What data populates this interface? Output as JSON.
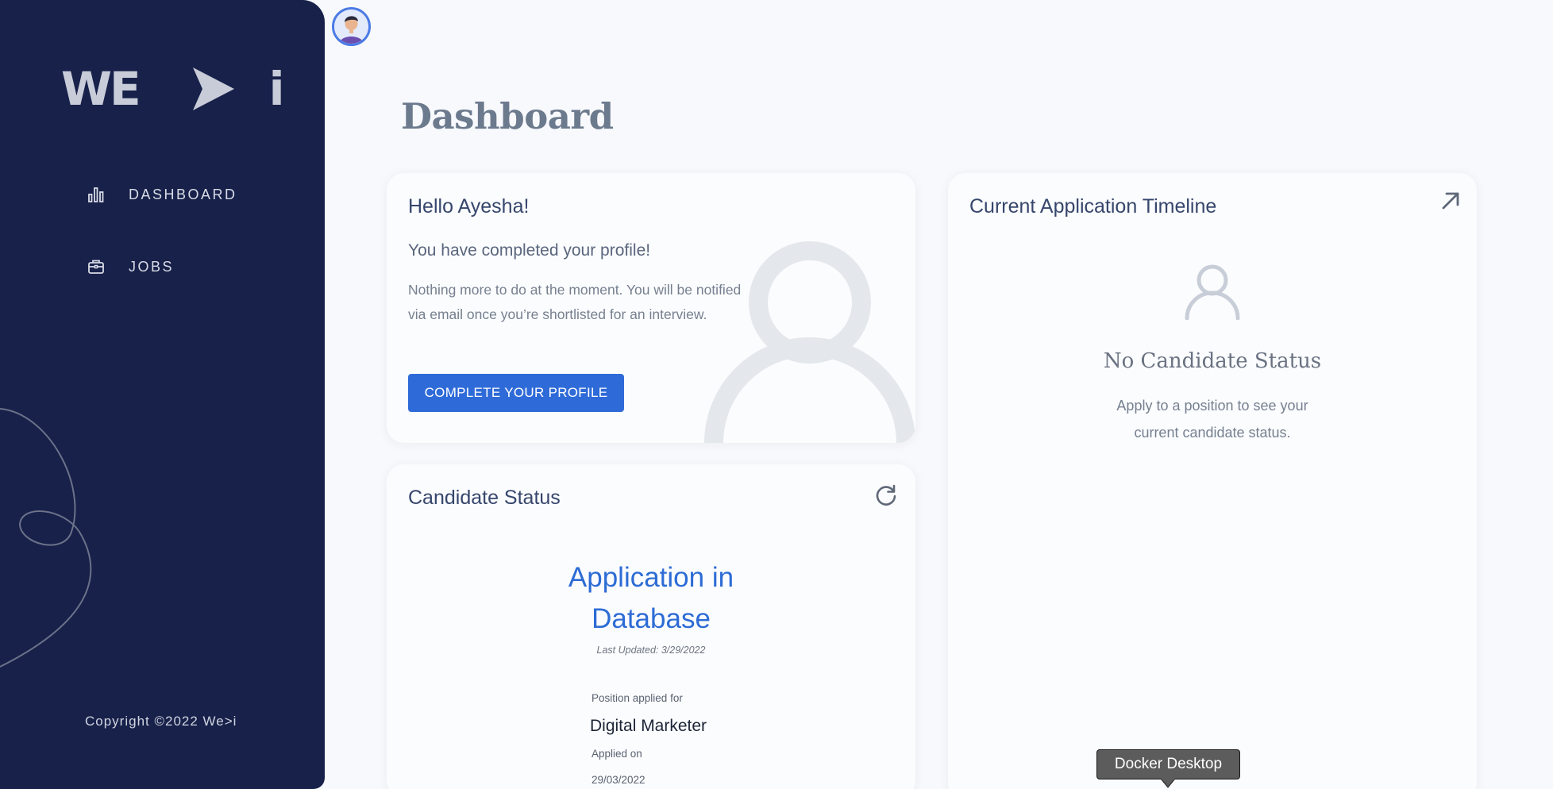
{
  "sidebar": {
    "logo": {
      "part1": "WE",
      "part3": "i"
    },
    "nav": [
      {
        "label": "DASHBOARD",
        "icon": "bar-chart-icon"
      },
      {
        "label": "JOBS",
        "icon": "briefcase-icon"
      }
    ],
    "copyright": "Copyright ©2022 We>i"
  },
  "header": {
    "title": "Dashboard"
  },
  "hello_card": {
    "title": "Hello Ayesha!",
    "subtitle": "You have completed your profile!",
    "description": "Nothing more to do at the moment. You will be notified via email once you’re shortlisted for an interview.",
    "button_label": "COMPLETE YOUR PROFILE"
  },
  "status_card": {
    "title": "Candidate Status",
    "status_line1": "Application in",
    "status_line2": "Database",
    "last_updated": "Last Updated: 3/29/2022",
    "position_label": "Position applied for",
    "position_value": "Digital Marketer",
    "applied_label": "Applied on",
    "applied_value": "29/03/2022"
  },
  "timeline_card": {
    "title": "Current Application Timeline",
    "empty_title": "No Candidate Status",
    "empty_description": "Apply to a position to see your current candidate status."
  },
  "tooltip": {
    "text": "Docker Desktop"
  },
  "colors": {
    "sidebar_bg": "#17214a",
    "accent": "#2f6bd8",
    "page_bg": "#f8f9fc"
  }
}
